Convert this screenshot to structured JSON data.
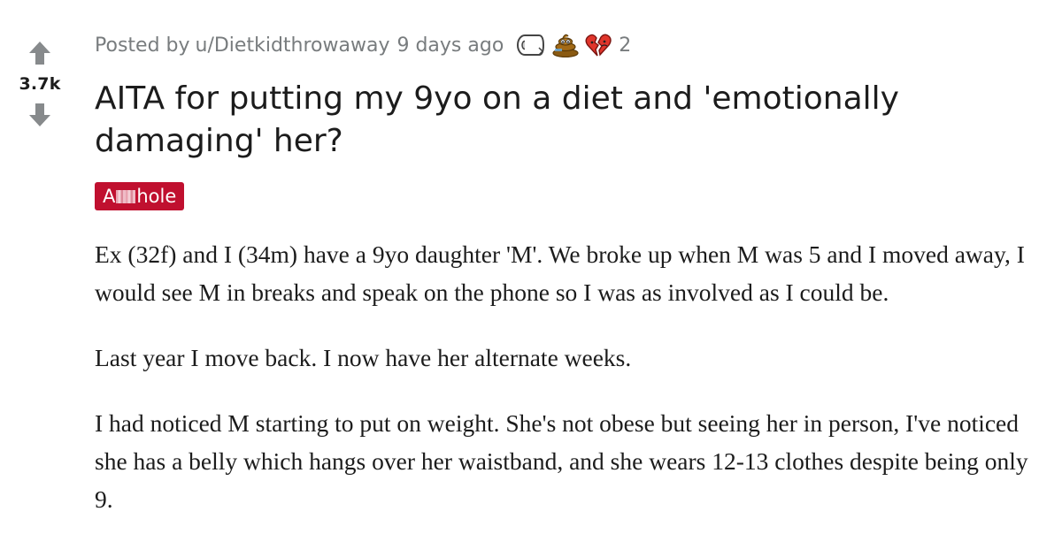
{
  "post": {
    "votes": "3.7k",
    "posted_by_label": "Posted by",
    "author": "u/Dietkidthrowaway",
    "time_ago": "9 days ago",
    "awards": [
      {
        "icon": "toilet-paper-icon"
      },
      {
        "icon": "poop-icon"
      },
      {
        "icon": "heart-broken-icon",
        "count": "2"
      }
    ],
    "title": "AITA for putting my 9yo on a diet and 'emotionally damaging' her?",
    "flair": {
      "prefix": "A",
      "suffix": "hole",
      "background": "#c0102f",
      "color": "#ffffff"
    },
    "paragraphs": [
      "Ex (32f) and I (34m) have a 9yo daughter 'M'. We broke up when M was 5 and I moved away, I would see M in breaks and speak on the phone so I was as involved as I could be.",
      "Last year I move back. I now have her alternate weeks.",
      "I had noticed M starting to put on weight. She's not obese but seeing her in person, I've noticed she has a belly which hangs over her waistband, and she wears 12-13 clothes despite being only 9."
    ]
  },
  "colors": {
    "meta_text": "#787c7e",
    "body_text": "#1c1c1c",
    "vote_arrow": "#878a8c"
  }
}
